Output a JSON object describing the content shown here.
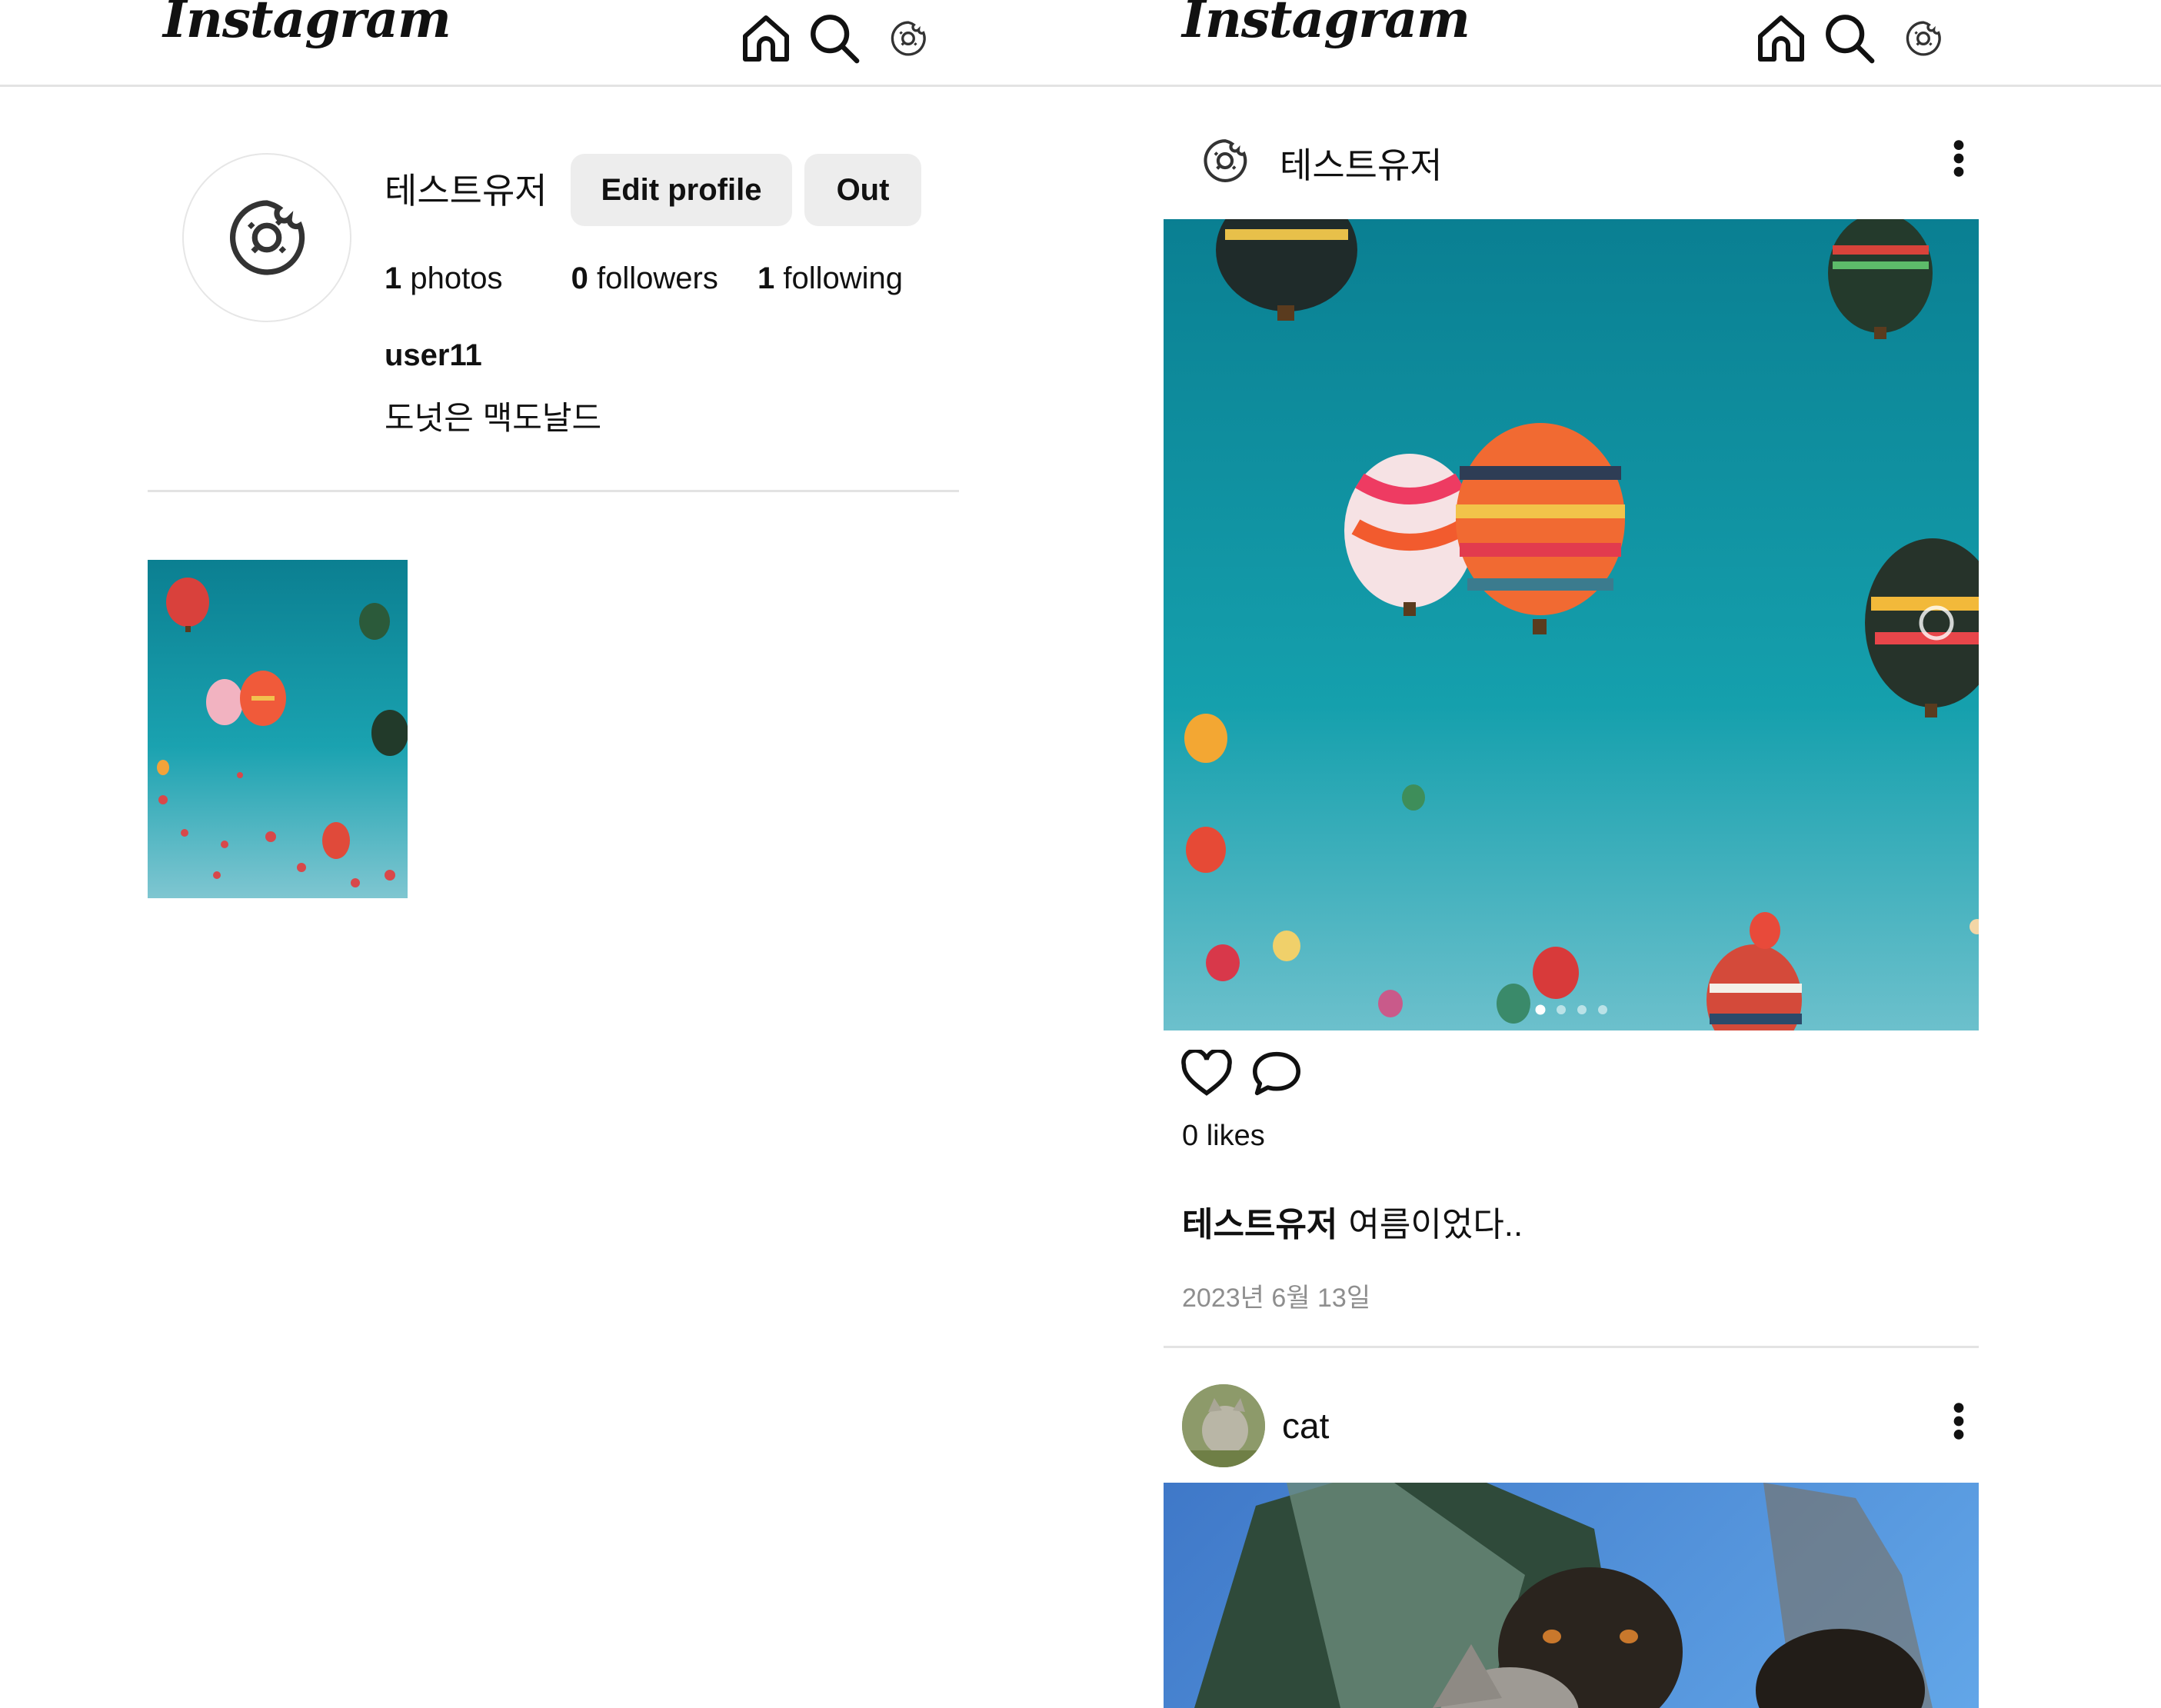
{
  "profile_view": {
    "logo": "Instagram",
    "nav": {
      "home_icon": "home-icon",
      "search_icon": "search-icon",
      "profile_icon": "donut-icon"
    },
    "profile": {
      "display_name": "테스트유저",
      "edit_button": "Edit profile",
      "logout_button": "Out",
      "stats": {
        "photos_count": "1",
        "photos_label": "photos",
        "followers_count": "0",
        "followers_label": "followers",
        "following_count": "1",
        "following_label": "following"
      },
      "username": "user11",
      "bio": "도넛은 맥도날드"
    },
    "grid": [
      {
        "kind": "photo",
        "subject": "hot air balloons"
      }
    ]
  },
  "feed_view": {
    "logo": "Instagram",
    "posts": [
      {
        "author": "테스트유저",
        "author_avatar_icon": "donut-icon",
        "image_subject": "hot air balloons",
        "carousel": {
          "total": 4,
          "current": 1
        },
        "likes_count": "0",
        "likes_label": "likes",
        "caption_author": "테스트유저",
        "caption_text": "여름이었다..",
        "date": "2023년 6월 13일"
      },
      {
        "author": "cat",
        "author_avatar_icon": "cat-photo",
        "image_subject": "dogs and cat under a tree"
      }
    ]
  },
  "colors": {
    "divider": "#e3e3e3",
    "button_bg": "#ededed",
    "sky": "#1aa2b0",
    "muted": "#8e8e8e"
  }
}
